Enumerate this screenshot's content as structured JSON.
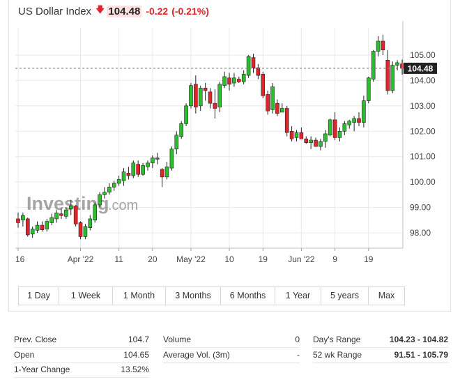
{
  "header": {
    "instrument_name": "US Dollar Index",
    "direction_icon": "down-arrow-icon",
    "price": "104.48",
    "change": "-0.22",
    "change_pct": "(-0.21%)"
  },
  "colors": {
    "up": "#2dbe2f",
    "down": "#e0242b",
    "price_label_bg": "#222222",
    "gridline": "#e8e8e8"
  },
  "watermark": {
    "brand": "Investing",
    "suffix": ".com"
  },
  "periods": [
    "1 Day",
    "1 Week",
    "1 Month",
    "3 Months",
    "6 Months",
    "1 Year",
    "5 years",
    "Max"
  ],
  "stats": {
    "col1": [
      {
        "label": "Prev. Close",
        "value": "104.7"
      },
      {
        "label": "Open",
        "value": "104.65"
      },
      {
        "label": "1-Year Change",
        "value": "13.52%"
      }
    ],
    "col2": [
      {
        "label": "Volume",
        "value": "0"
      },
      {
        "label": "Average Vol. (3m)",
        "value": "-"
      }
    ],
    "col3": [
      {
        "label": "Day's Range",
        "value": "104.23 - 104.82"
      },
      {
        "label": "52 wk Range",
        "value": "91.51 - 105.79"
      }
    ]
  },
  "chart_data": {
    "type": "candlestick",
    "title": "US Dollar Index",
    "xlabel": "",
    "ylabel": "",
    "ylim": [
      97.5,
      105.8
    ],
    "y_ticks": [
      "98.00",
      "99.00",
      "100.00",
      "101.00",
      "102.00",
      "103.00",
      "104.00",
      "105.00"
    ],
    "x_ticks": [
      "16",
      "Apr '22",
      "11",
      "20",
      "May '22",
      "10",
      "19",
      "Jun '22",
      "9",
      "19"
    ],
    "x_tick_index": [
      0,
      13,
      21,
      28,
      36,
      44,
      51,
      59,
      66,
      73
    ],
    "last_price": "104.48",
    "last_price_value": 104.48,
    "grid": true,
    "legend": "none",
    "ohlc": [
      [
        98.55,
        98.8,
        98.2,
        98.4
      ],
      [
        98.5,
        98.8,
        98.25,
        98.68
      ],
      [
        98.55,
        98.6,
        97.85,
        97.92
      ],
      [
        97.95,
        98.25,
        97.8,
        98.15
      ],
      [
        98.1,
        98.45,
        98.0,
        98.3
      ],
      [
        98.3,
        98.45,
        98.05,
        98.12
      ],
      [
        98.15,
        98.55,
        98.05,
        98.45
      ],
      [
        98.4,
        98.75,
        98.3,
        98.6
      ],
      [
        98.55,
        98.9,
        98.4,
        98.78
      ],
      [
        98.75,
        98.95,
        98.55,
        98.68
      ],
      [
        98.65,
        99.0,
        98.55,
        98.9
      ],
      [
        98.95,
        99.3,
        98.7,
        99.05
      ],
      [
        99.05,
        99.1,
        98.25,
        98.35
      ],
      [
        98.4,
        98.45,
        97.75,
        97.85
      ],
      [
        97.85,
        98.35,
        97.75,
        98.25
      ],
      [
        98.2,
        98.7,
        98.1,
        98.55
      ],
      [
        98.5,
        99.2,
        98.4,
        99.1
      ],
      [
        99.1,
        99.6,
        99.0,
        99.5
      ],
      [
        99.5,
        99.8,
        99.35,
        99.6
      ],
      [
        99.6,
        99.95,
        99.5,
        99.8
      ],
      [
        99.8,
        100.05,
        99.65,
        99.95
      ],
      [
        99.95,
        100.25,
        99.85,
        100.1
      ],
      [
        100.05,
        100.55,
        99.85,
        100.4
      ],
      [
        100.35,
        100.6,
        100.1,
        100.25
      ],
      [
        100.25,
        100.85,
        100.15,
        100.75
      ],
      [
        100.7,
        100.85,
        100.2,
        100.3
      ],
      [
        100.3,
        100.75,
        100.25,
        100.65
      ],
      [
        100.6,
        100.85,
        100.45,
        100.75
      ],
      [
        100.75,
        101.05,
        100.55,
        100.95
      ],
      [
        100.95,
        101.15,
        100.7,
        100.9
      ],
      [
        100.5,
        100.55,
        99.8,
        100.2
      ],
      [
        100.2,
        100.8,
        100.1,
        100.6
      ],
      [
        100.55,
        101.4,
        100.45,
        101.3
      ],
      [
        101.3,
        102.0,
        101.1,
        101.85
      ],
      [
        101.8,
        102.4,
        101.7,
        102.3
      ],
      [
        102.3,
        103.1,
        102.2,
        103.0
      ],
      [
        103.0,
        103.9,
        102.9,
        103.8
      ],
      [
        103.85,
        104.2,
        102.7,
        102.95
      ],
      [
        103.0,
        103.8,
        102.8,
        103.7
      ],
      [
        103.7,
        103.9,
        103.2,
        103.6
      ],
      [
        103.55,
        103.7,
        102.9,
        103.1
      ],
      [
        103.1,
        103.65,
        102.5,
        102.9
      ],
      [
        102.95,
        103.95,
        102.75,
        103.85
      ],
      [
        103.8,
        104.35,
        103.7,
        104.15
      ],
      [
        104.1,
        104.3,
        103.6,
        103.85
      ],
      [
        103.9,
        104.3,
        103.75,
        104.1
      ],
      [
        104.05,
        104.15,
        103.9,
        103.95
      ],
      [
        103.95,
        104.4,
        103.85,
        104.25
      ],
      [
        104.2,
        105.0,
        104.1,
        104.95
      ],
      [
        104.9,
        105.05,
        104.3,
        104.5
      ],
      [
        104.5,
        104.65,
        104.05,
        104.2
      ],
      [
        104.25,
        104.35,
        103.3,
        103.4
      ],
      [
        103.45,
        103.6,
        102.65,
        102.8
      ],
      [
        102.85,
        103.9,
        102.7,
        103.75
      ],
      [
        103.1,
        103.25,
        102.6,
        102.7
      ],
      [
        102.75,
        103.1,
        102.75,
        102.9
      ],
      [
        102.9,
        103.0,
        101.8,
        101.95
      ],
      [
        102.0,
        102.2,
        101.6,
        101.7
      ],
      [
        101.75,
        102.05,
        101.6,
        101.95
      ],
      [
        101.95,
        102.15,
        101.75,
        101.7
      ],
      [
        101.7,
        101.8,
        101.5,
        101.55
      ],
      [
        101.55,
        101.8,
        101.3,
        101.65
      ],
      [
        101.65,
        101.75,
        101.45,
        101.4
      ],
      [
        101.4,
        101.7,
        101.25,
        101.6
      ],
      [
        101.6,
        102.05,
        101.35,
        101.9
      ],
      [
        101.85,
        102.5,
        101.8,
        102.45
      ],
      [
        102.45,
        102.75,
        101.65,
        101.75
      ],
      [
        101.75,
        102.15,
        101.6,
        102.0
      ],
      [
        102.0,
        102.4,
        101.85,
        102.3
      ],
      [
        102.25,
        102.45,
        102.1,
        102.4
      ],
      [
        102.35,
        102.6,
        102.0,
        102.5
      ],
      [
        102.5,
        102.75,
        102.2,
        102.35
      ],
      [
        102.35,
        103.4,
        102.15,
        103.2
      ],
      [
        103.2,
        104.15,
        103.1,
        104.1
      ],
      [
        104.05,
        105.2,
        103.95,
        105.15
      ],
      [
        105.15,
        105.75,
        104.95,
        105.55
      ],
      [
        105.55,
        105.8,
        105.0,
        105.2
      ],
      [
        104.8,
        105.2,
        103.45,
        103.6
      ],
      [
        103.6,
        104.75,
        103.5,
        104.6
      ],
      [
        104.6,
        104.8,
        104.4,
        104.7
      ],
      [
        104.65,
        104.82,
        104.23,
        104.48
      ]
    ]
  }
}
